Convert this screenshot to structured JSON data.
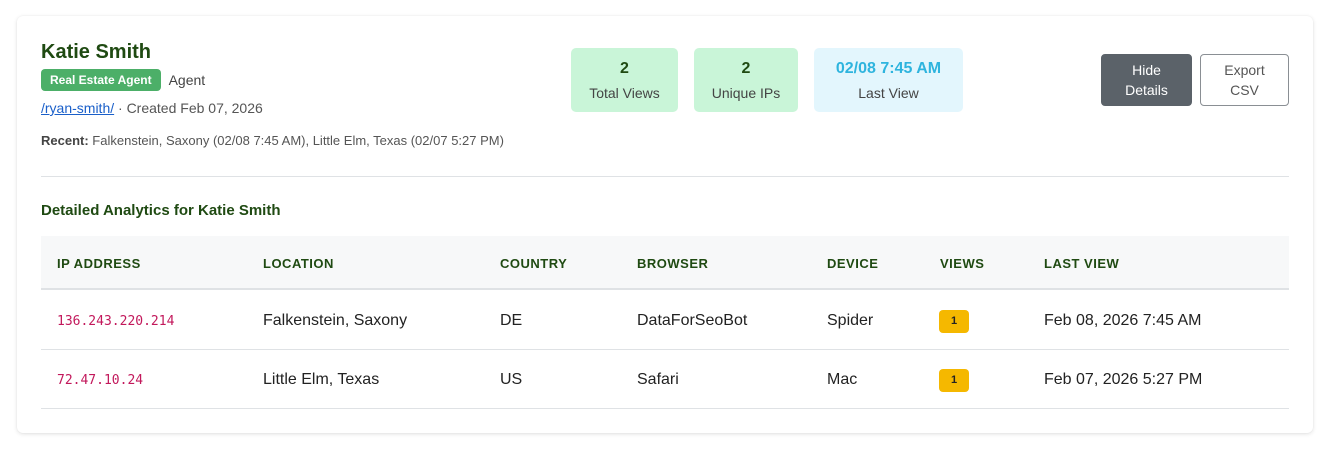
{
  "profile": {
    "name": "Katie Smith",
    "badge": "Real Estate Agent",
    "role": "Agent",
    "link": "/ryan-smith/",
    "created": " · Created Feb 07, 2026",
    "recent_label": "Recent:",
    "recent_text": " Falkenstein, Saxony (02/08 7:45 AM), Little Elm, Texas (02/07 5:27 PM)"
  },
  "stats": [
    {
      "value": "2",
      "label": "Total Views"
    },
    {
      "value": "2",
      "label": "Unique IPs"
    },
    {
      "value": "02/08 7:45 AM",
      "label": "Last View"
    }
  ],
  "buttons": {
    "hide_details_line1": "Hide",
    "hide_details_line2": "Details",
    "export_line1": "Export",
    "export_line2": "CSV"
  },
  "section_title": "Detailed Analytics for Katie Smith",
  "table": {
    "headers": [
      "IP ADDRESS",
      "LOCATION",
      "COUNTRY",
      "BROWSER",
      "DEVICE",
      "VIEWS",
      "LAST VIEW"
    ],
    "rows": [
      {
        "ip": "136.243.220.214",
        "location": "Falkenstein, Saxony",
        "country": "DE",
        "browser": "DataForSeoBot",
        "device": "Spider",
        "views": "1",
        "last_view": "Feb 08, 2026 7:45 AM"
      },
      {
        "ip": "72.47.10.24",
        "location": "Little Elm, Texas",
        "country": "US",
        "browser": "Safari",
        "device": "Mac",
        "views": "1",
        "last_view": "Feb 07, 2026 5:27 PM"
      }
    ]
  },
  "colors": {
    "heading_green": "#1f4a12",
    "badge_green": "#4caf68",
    "stat_green_bg": "#c9f5d8",
    "stat_blue_bg": "#e3f6fd",
    "stat_blue_text": "#2eb4de",
    "ip_pink": "#c2185b",
    "views_badge_yellow": "#f5b800"
  }
}
